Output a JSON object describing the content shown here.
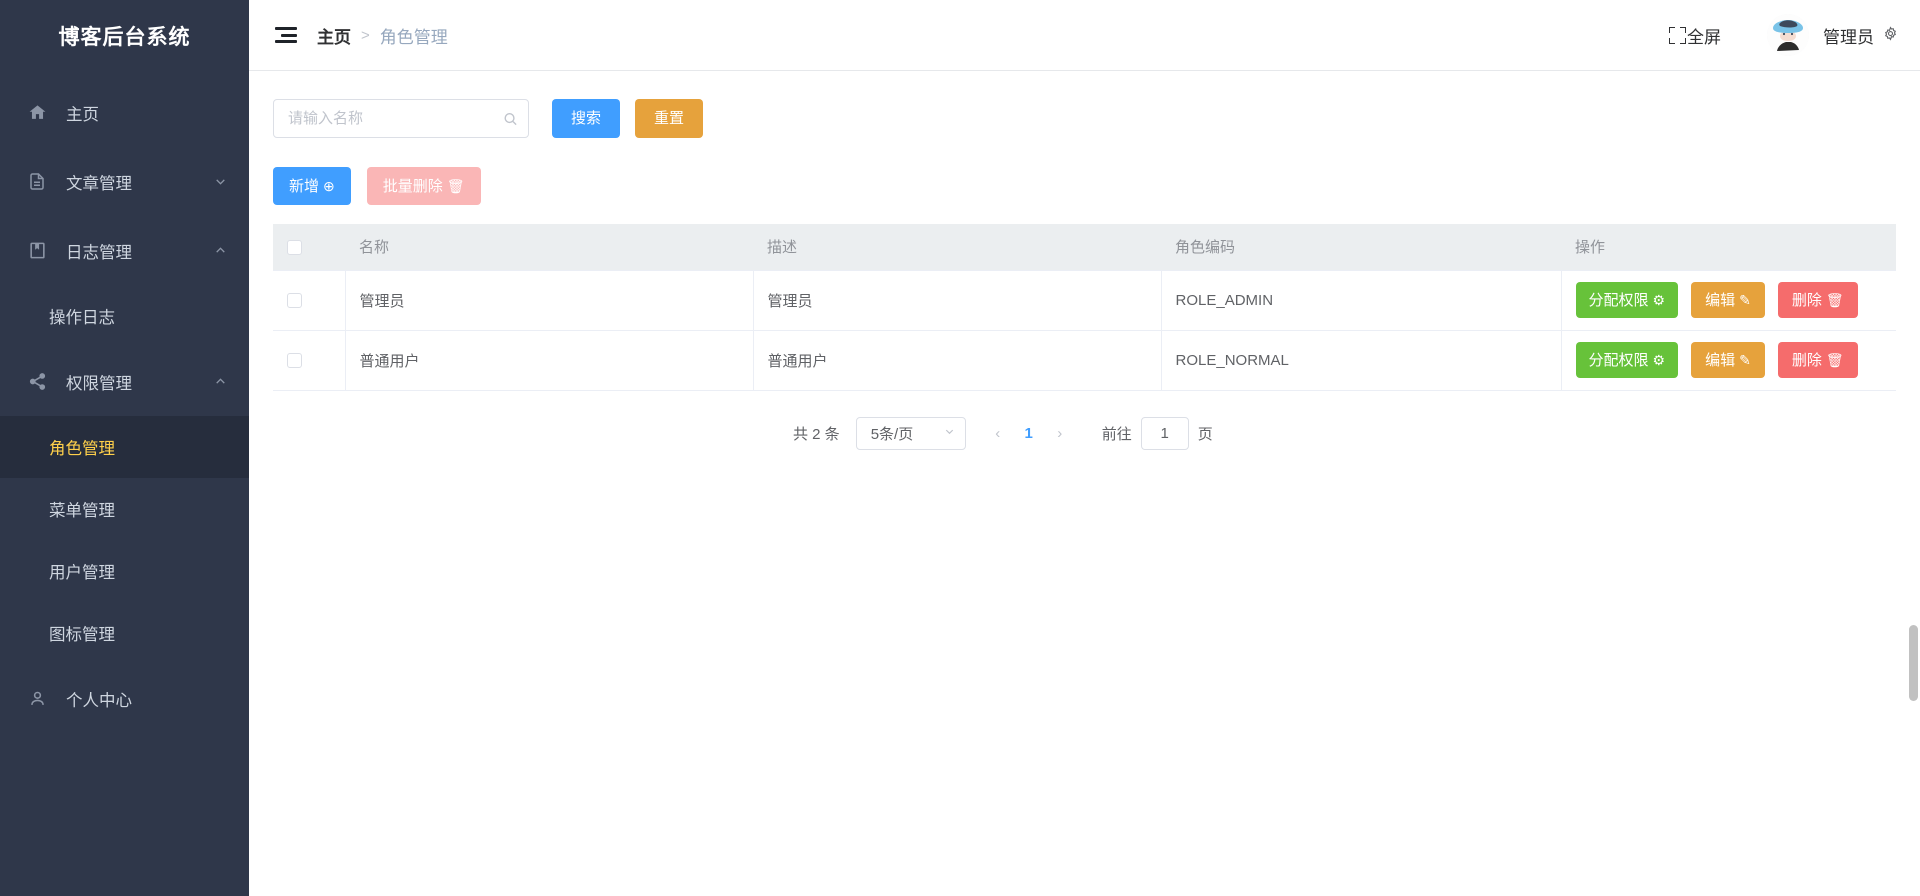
{
  "sidebar": {
    "brand": "博客后台系统",
    "items": [
      {
        "label": "主页",
        "icon": "home-icon",
        "arrow": ""
      },
      {
        "label": "文章管理",
        "icon": "document-icon",
        "arrow": "chevron-down-icon"
      },
      {
        "label": "日志管理",
        "icon": "book-icon",
        "arrow": "chevron-up-icon"
      },
      {
        "label": "操作日志",
        "icon": "",
        "arrow": "",
        "sub": true
      },
      {
        "label": "权限管理",
        "icon": "share-icon",
        "arrow": "chevron-up-icon"
      },
      {
        "label": "角色管理",
        "icon": "",
        "arrow": "",
        "sub": true,
        "active": true
      },
      {
        "label": "菜单管理",
        "icon": "",
        "arrow": "",
        "sub": true
      },
      {
        "label": "用户管理",
        "icon": "",
        "arrow": "",
        "sub": true
      },
      {
        "label": "图标管理",
        "icon": "",
        "arrow": "",
        "sub": true
      },
      {
        "label": "个人中心",
        "icon": "user-icon",
        "arrow": ""
      }
    ],
    "active_color": "#ffd04b",
    "background": "#2f374a"
  },
  "topbar": {
    "hamburger_icon": "fold-menu-icon",
    "breadcrumb": {
      "home": "主页",
      "separator": ">",
      "current": "角色管理"
    },
    "fullscreen_label": "全屏",
    "fullscreen_icon": "fullscreen-icon",
    "avatar_icon": "user-avatar",
    "username": "管理员",
    "gear_icon": "gear-icon"
  },
  "filter": {
    "search_placeholder": "请输入名称",
    "search_value": "",
    "search_icon": "search-icon",
    "search_button": "搜索",
    "reset_button": "重置"
  },
  "actions": {
    "add_label": "新增",
    "add_icon": "⊕",
    "bulk_delete_label": "批量删除",
    "bulk_delete_icon": "🗑",
    "add_color": "#409eff",
    "bulk_color": "#fab6b6"
  },
  "table": {
    "columns": [
      "",
      "名称",
      "描述",
      "角色编码",
      "操作"
    ],
    "rows": [
      {
        "name": "管理员",
        "desc": "管理员",
        "code": "ROLE_ADMIN"
      },
      {
        "name": "普通用户",
        "desc": "普通用户",
        "code": "ROLE_NORMAL"
      }
    ],
    "row_actions": {
      "assign_label": "分配权限",
      "assign_icon": "⚙",
      "edit_label": "编辑",
      "edit_icon": "✎",
      "delete_label": "删除",
      "delete_icon": "🗑",
      "assign_color": "#67c23a",
      "edit_color": "#e6a23c",
      "delete_color": "#f56c6c"
    }
  },
  "pagination": {
    "total_text": "共 2 条",
    "page_size": "5条/页",
    "prev_icon": "‹",
    "next_icon": "›",
    "current_page": "1",
    "jump_label": "前往",
    "jump_value": "1",
    "jump_suffix": "页",
    "active_color": "#409eff"
  }
}
